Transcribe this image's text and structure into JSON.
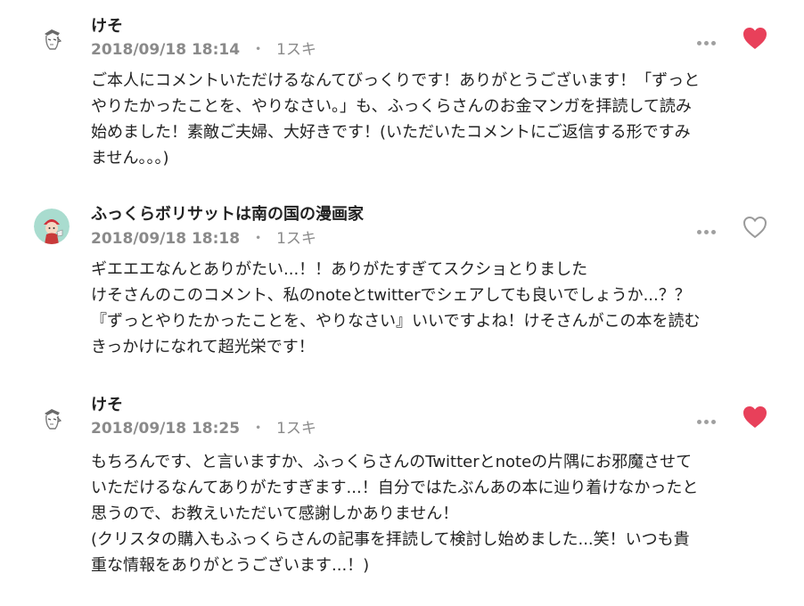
{
  "comments": [
    {
      "author": "けそ",
      "date": "2018/09/18 18:14",
      "separator": "・",
      "likes": "1スキ",
      "liked": true,
      "avatar_icon": "sketch-character-avatar-icon",
      "lines": [
        "ご本人にコメントいただけるなんてびっくりです！ありがとうございます！「ずっと",
        "やりたかったことを、やりなさい。」も、ふっくらさんのお金マンガを拝読して読み",
        "始めました！素敵ご夫婦、大好きです！(いただいたコメントにご返信する形ですみ",
        "ません。。。)"
      ]
    },
    {
      "author": "ふっくらボリサットは南の国の漫画家",
      "date": "2018/09/18 18:18",
      "separator": "・",
      "likes": "1スキ",
      "liked": false,
      "avatar_icon": "illustrated-character-avatar-icon",
      "lines": [
        "ギエエエなんとありがたい...！！ありがたすぎてスクショとりました",
        "けそさんのこのコメント、私のnoteとtwitterでシェアしても良いでしょうか...？？",
        "『ずっとやりたかったことを、やりなさい』いいですよね！けそさんがこの本を読む",
        "きっかけになれて超光栄です！"
      ]
    },
    {
      "author": "けそ",
      "date": "2018/09/18 18:25",
      "separator": "・",
      "likes": "1スキ",
      "liked": true,
      "avatar_icon": "sketch-character-avatar-icon",
      "lines": [
        "もちろんです、と言いますか、ふっくらさんのTwitterとnoteの片隅にお邪魔させて",
        "いただけるなんてありがたすぎます...！自分ではたぶんあの本に辿り着けなかったと",
        "思うので、お教えいただいて感謝しかありません！",
        "(クリスタの購入もふっくらさんの記事を拝読して検討し始めました...笑！いつも貴",
        "重な情報をありがとうございます...！)"
      ]
    }
  ],
  "colors": {
    "heart_liked": "#e8405a",
    "heart_unliked": "#9a9a9a",
    "meta_text": "#8a8a8a",
    "body_text": "#222222"
  },
  "icons": {
    "more": "more-options-icon",
    "like": "heart-icon"
  }
}
